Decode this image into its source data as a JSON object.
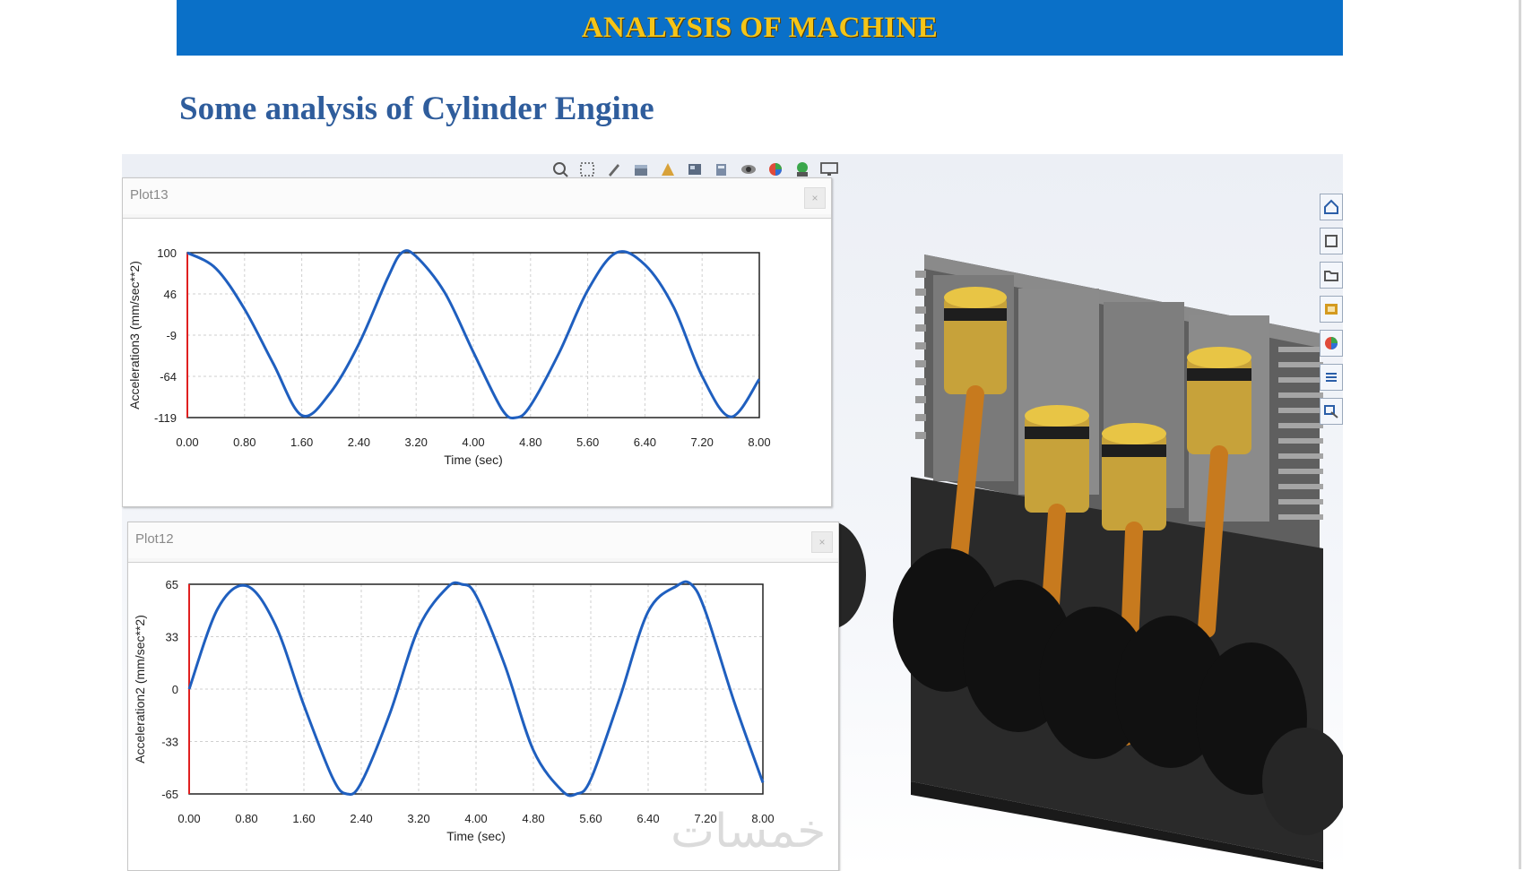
{
  "banner": {
    "title": "ANALYSIS OF MACHINE"
  },
  "heading": "Some analysis of Cylinder Engine",
  "toolbar_icons": [
    "zoom-fit-icon",
    "zoom-area-icon",
    "previous-view-icon",
    "section-view-icon",
    "dynamic-annotation-icon",
    "view-orientation-icon",
    "display-style-icon",
    "hide-show-icon",
    "edit-appearance-icon",
    "apply-scene-icon",
    "view-settings-icon"
  ],
  "right_rail_icons": [
    "home-icon",
    "part-icon",
    "folder-icon",
    "library-icon",
    "appearance-icon",
    "properties-icon",
    "custom-icon"
  ],
  "plots": [
    {
      "title": "Plot13",
      "close_label": "×",
      "chart_data": {
        "type": "line",
        "xlabel": "Time (sec)",
        "ylabel": "Acceleration3 (mm/sec**2)",
        "xticks": [
          "0.00",
          "0.80",
          "1.60",
          "2.40",
          "3.20",
          "4.00",
          "4.80",
          "5.60",
          "6.40",
          "7.20",
          "8.00"
        ],
        "yticks": [
          "100",
          "46",
          "-9",
          "-64",
          "-119"
        ],
        "xlim": [
          0,
          8
        ],
        "ylim": [
          -119,
          100
        ],
        "series": [
          {
            "x": [
              0,
              0.4,
              0.8,
              1.2,
              1.6,
              2.0,
              2.4,
              2.8,
              3.0,
              3.2,
              3.6,
              4.0,
              4.4,
              4.6,
              4.8,
              5.2,
              5.6,
              6.0,
              6.4,
              6.8,
              7.2,
              7.6,
              8.0
            ],
            "y": [
              100,
              79,
              25,
              -47,
              -116,
              -86,
              -21,
              66,
              100,
              95,
              47,
              -32,
              -108,
              -119,
              -103,
              -33,
              50,
              100,
              84,
              28,
              -64,
              -118,
              -68
            ]
          }
        ]
      }
    },
    {
      "title": "Plot12",
      "close_label": "×",
      "chart_data": {
        "type": "line",
        "xlabel": "Time (sec)",
        "ylabel": "Acceleration2 (mm/sec**2)",
        "xticks": [
          "0.00",
          "0.80",
          "1.60",
          "2.40",
          "3.20",
          "4.00",
          "4.80",
          "5.60",
          "6.40",
          "7.20",
          "8.00"
        ],
        "yticks": [
          "65",
          "33",
          "0",
          "-33",
          "-65"
        ],
        "xlim": [
          0,
          8
        ],
        "ylim": [
          -65,
          65
        ],
        "series": [
          {
            "x": [
              0,
              0.4,
              0.8,
              1.2,
              1.6,
              2.0,
              2.2,
              2.4,
              2.8,
              3.2,
              3.6,
              3.8,
              4.0,
              4.4,
              4.8,
              5.2,
              5.4,
              5.6,
              6.0,
              6.4,
              6.8,
              7.0,
              7.2,
              7.6,
              8.0
            ],
            "y": [
              0,
              50,
              64,
              40,
              -10,
              -55,
              -65,
              -58,
              -15,
              38,
              63,
              65,
              58,
              15,
              -38,
              -63,
              -65,
              -56,
              -6,
              48,
              64,
              65,
              48,
              -8,
              -58
            ]
          }
        ]
      }
    }
  ],
  "watermark": "خمسات"
}
